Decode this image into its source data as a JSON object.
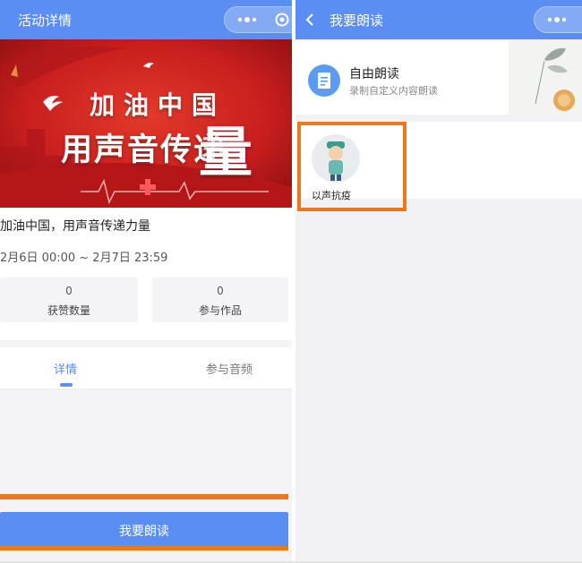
{
  "left": {
    "nav_title": "活动详情",
    "banner": {
      "line1": "加油中国",
      "line2": "用声音传递",
      "big_char": "量"
    },
    "activity_title": "加油中国，用声音传递力量",
    "activity_time": "2月6日 00:00 ~ 2月7日 23:59",
    "stats": [
      {
        "value": "0",
        "label": "获赞数量"
      },
      {
        "value": "0",
        "label": "参与作品"
      }
    ],
    "tabs": [
      "详情",
      "参与音频"
    ],
    "read_button": "我要朗读"
  },
  "right": {
    "nav_title": "我要朗读",
    "free_read": {
      "title": "自由朗读",
      "subtitle": "录制自定义内容朗读"
    },
    "items": [
      {
        "label": "以声抗疫"
      }
    ]
  },
  "colors": {
    "accent": "#5b8ef2",
    "highlight": "#f0761d",
    "banner_red": "#c81e1e"
  },
  "icons": [
    "back-icon",
    "more-icon",
    "target-icon",
    "document-icon",
    "doctor-avatar"
  ]
}
